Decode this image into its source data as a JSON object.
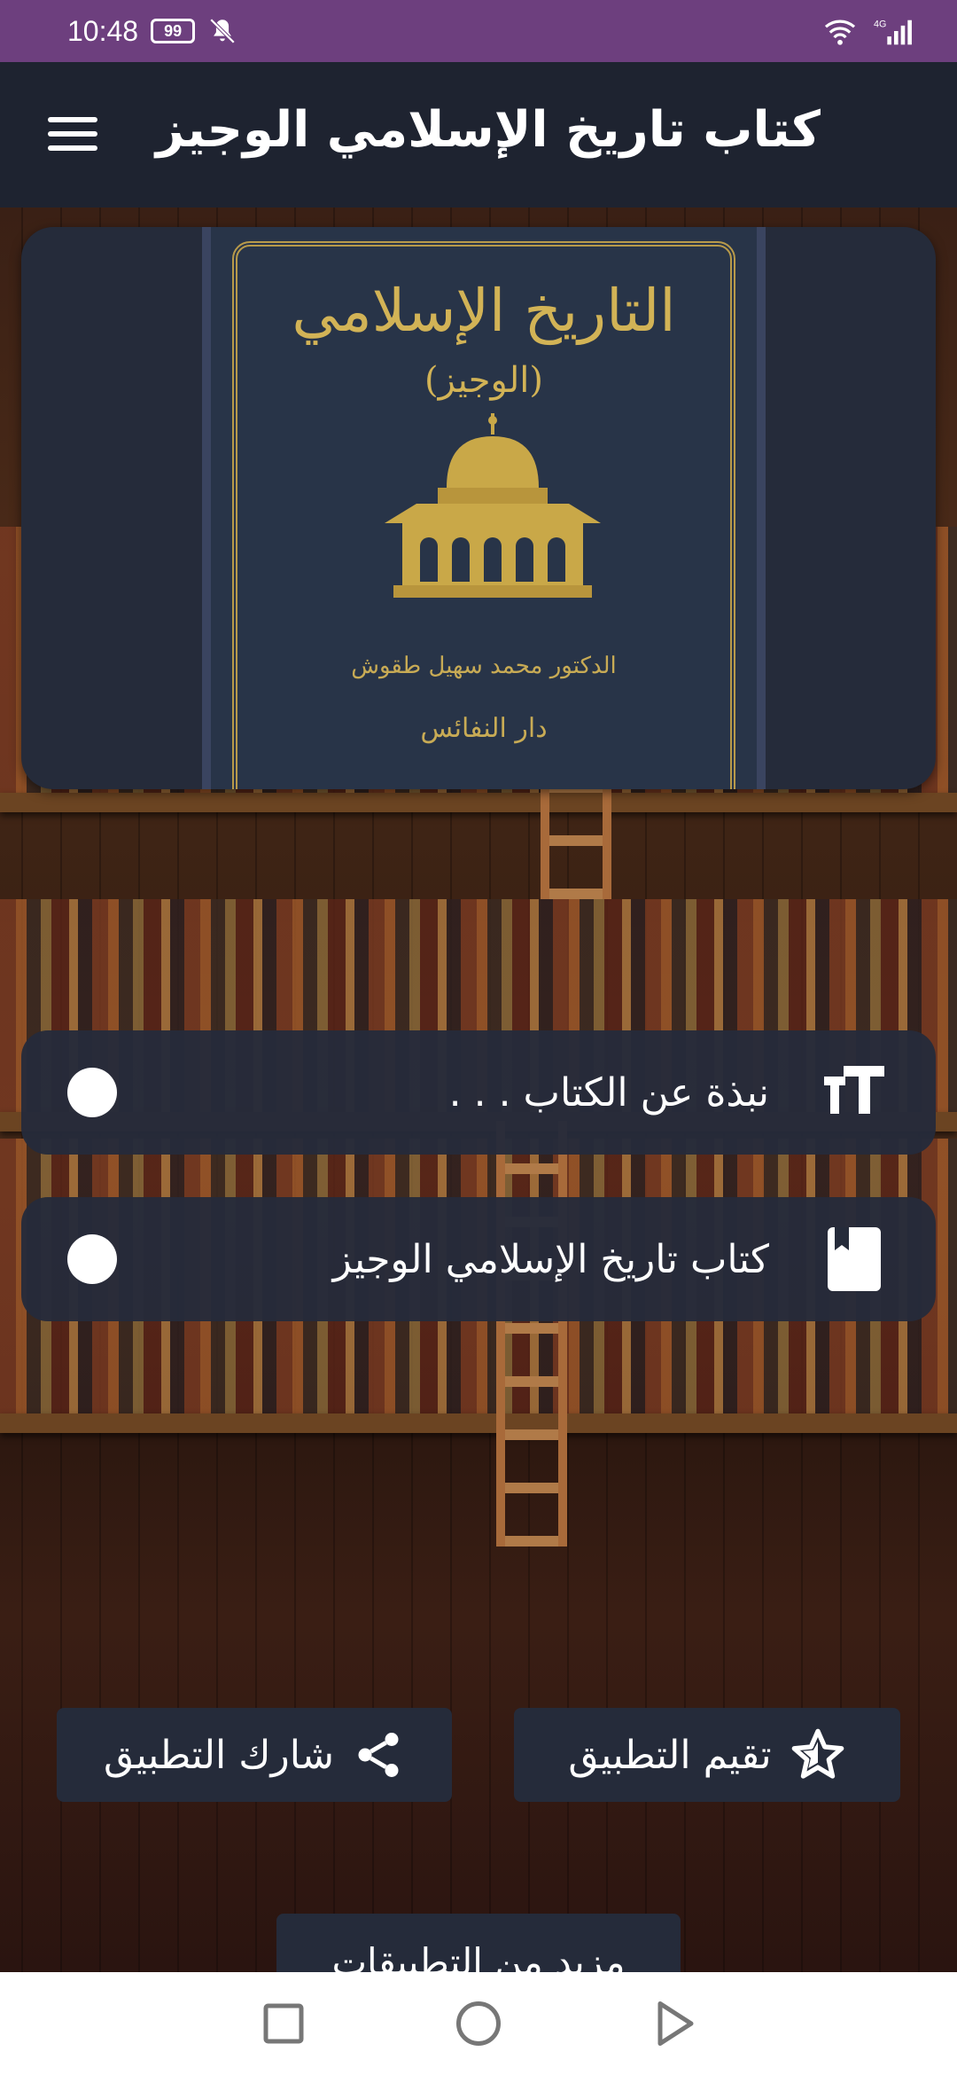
{
  "status_bar": {
    "time": "10:48",
    "battery": "99"
  },
  "app_bar": {
    "title": "كتاب تاريخ الإسلامي الوجيز"
  },
  "cover": {
    "title": "التاريخ الإسلامي",
    "subtitle": "(الوجيز)",
    "author": "الدكتور محمد سهيل طقوش",
    "publisher": "دار النفائس"
  },
  "menu": {
    "items": [
      {
        "label": "نبذة عن الكتاب . . .",
        "icon": "text-size-icon"
      },
      {
        "label": "كتاب تاريخ الإسلامي الوجيز",
        "icon": "book-icon"
      }
    ]
  },
  "actions": {
    "rate_label": "تقيم التطبيق",
    "share_label": "شارك التطبيق",
    "more_label": "مزيد من التطبيقات"
  },
  "colors": {
    "status_bar": "#6d3f7e",
    "app_bar": "#1e2330",
    "card": "#252b3a",
    "cover_gold": "#d2b356"
  }
}
